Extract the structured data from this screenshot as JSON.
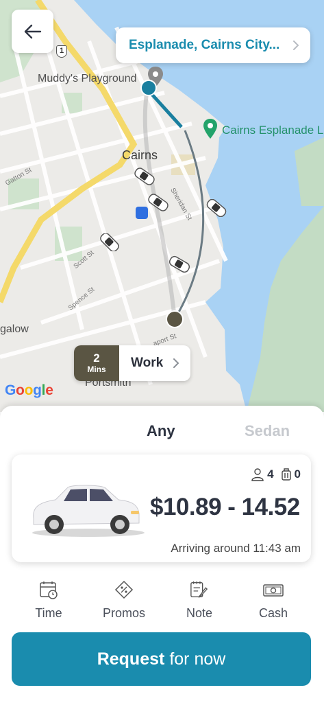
{
  "map": {
    "destination": "Esplanade, Cairns City...",
    "labels": {
      "muddys": "Muddy's Playground",
      "cairns": "Cairns",
      "esplanade_poi": "Cairns Esplanade La",
      "bungalow": "galow",
      "portsmith": "Portsmith"
    },
    "streets": {
      "gatton": "Gatton St",
      "sheridan": "Sheridan St",
      "scott": "Scott St",
      "spence": "Spence St",
      "aport": "aport St"
    },
    "highway_shield": "1",
    "eta": {
      "value": "2",
      "unit": "Mins",
      "label": "Work"
    },
    "google": "Google"
  },
  "sheet": {
    "tabs": [
      "Any",
      "Sedan"
    ],
    "ride": {
      "passengers": "4",
      "luggage": "0",
      "price": "$10.89 - 14.52",
      "arriving": "Arriving around 11:43 am"
    },
    "options": [
      "Time",
      "Promos",
      "Note",
      "Cash"
    ],
    "request": {
      "strong": "Request",
      "rest": "for now"
    }
  },
  "colors": {
    "accent": "#1a8cae",
    "eta_dark": "#5a5543",
    "water": "#a9d2f4",
    "poi": "#23916a"
  }
}
